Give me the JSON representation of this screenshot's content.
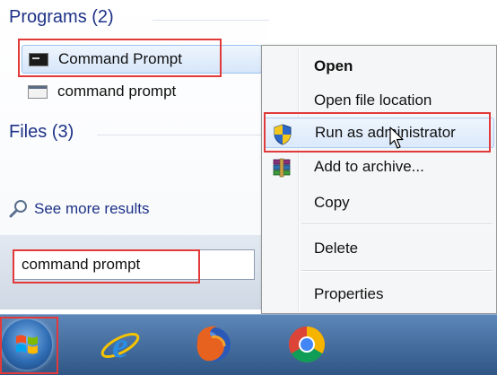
{
  "search_results": {
    "programs_header": "Programs (2)",
    "files_header": "Files (3)",
    "programs": [
      {
        "label": "Command Prompt"
      },
      {
        "label": "command prompt"
      }
    ],
    "see_more": "See more results"
  },
  "search": {
    "value": "command prompt"
  },
  "context_menu": {
    "open": "Open",
    "open_location": "Open file location",
    "run_as_admin": "Run as administrator",
    "add_archive": "Add to archive...",
    "copy": "Copy",
    "delete": "Delete",
    "properties": "Properties"
  },
  "taskbar": {
    "apps": [
      "start-orb-icon",
      "internet-explorer-icon",
      "firefox-icon",
      "chrome-icon"
    ]
  },
  "colors": {
    "highlight": "#e23a3a",
    "header_text": "#1e3287",
    "taskbar": "#3e6799"
  }
}
